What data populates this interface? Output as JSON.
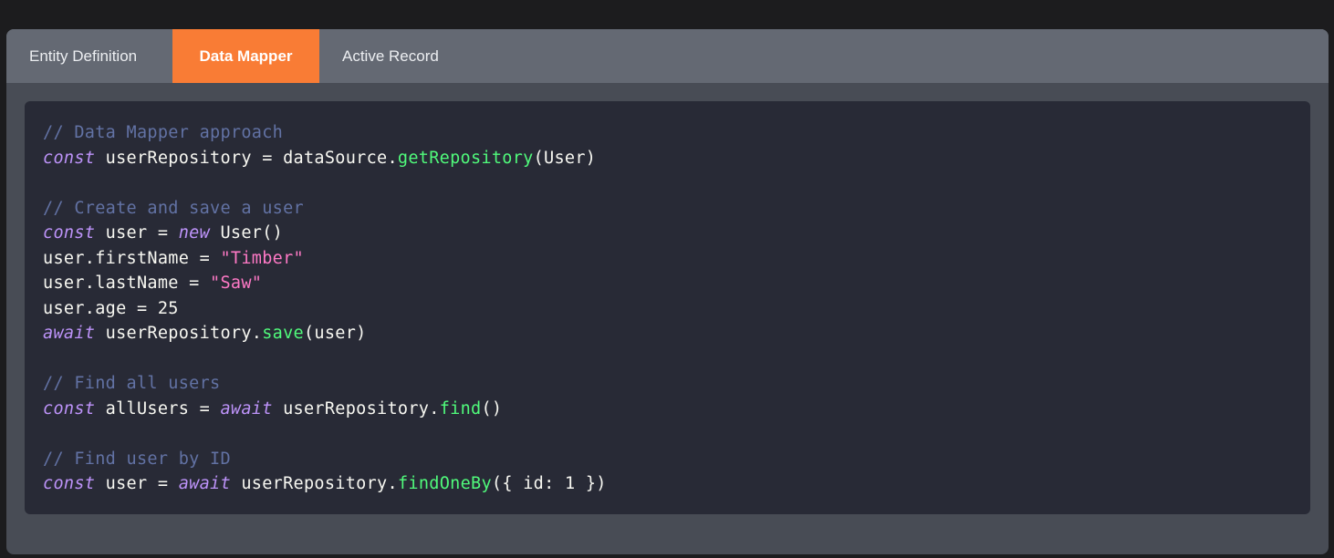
{
  "colors": {
    "active_tab": "#f97c35",
    "panel_bg": "#484c55",
    "tab_bar_bg": "#646973",
    "code_bg": "#282a36",
    "comment": "#6272a4",
    "keyword": "#bd93f9",
    "function": "#50fa7b",
    "string": "#ff79c6",
    "text": "#f8f8f2"
  },
  "tabs": [
    {
      "label": "Entity Definition",
      "active": false
    },
    {
      "label": "Data Mapper",
      "active": true
    },
    {
      "label": "Active Record",
      "active": false
    }
  ],
  "code": {
    "lines": [
      [
        {
          "t": "// Data Mapper approach",
          "k": "cm"
        }
      ],
      [
        {
          "t": "const",
          "k": "kw"
        },
        {
          "t": " userRepository = dataSource.",
          "k": "tx"
        },
        {
          "t": "getRepository",
          "k": "fn"
        },
        {
          "t": "(User)",
          "k": "tx"
        }
      ],
      [],
      [
        {
          "t": "// Create and save a user",
          "k": "cm"
        }
      ],
      [
        {
          "t": "const",
          "k": "kw"
        },
        {
          "t": " user = ",
          "k": "tx"
        },
        {
          "t": "new",
          "k": "kw"
        },
        {
          "t": " User()",
          "k": "tx"
        }
      ],
      [
        {
          "t": "user.firstName = ",
          "k": "tx"
        },
        {
          "t": "\"Timber\"",
          "k": "str"
        }
      ],
      [
        {
          "t": "user.lastName = ",
          "k": "tx"
        },
        {
          "t": "\"Saw\"",
          "k": "str"
        }
      ],
      [
        {
          "t": "user.age = 25",
          "k": "tx"
        }
      ],
      [
        {
          "t": "await",
          "k": "kw"
        },
        {
          "t": " userRepository.",
          "k": "tx"
        },
        {
          "t": "save",
          "k": "fn"
        },
        {
          "t": "(user)",
          "k": "tx"
        }
      ],
      [],
      [
        {
          "t": "// Find all users",
          "k": "cm"
        }
      ],
      [
        {
          "t": "const",
          "k": "kw"
        },
        {
          "t": " allUsers = ",
          "k": "tx"
        },
        {
          "t": "await",
          "k": "kw"
        },
        {
          "t": " userRepository.",
          "k": "tx"
        },
        {
          "t": "find",
          "k": "fn"
        },
        {
          "t": "()",
          "k": "tx"
        }
      ],
      [],
      [
        {
          "t": "// Find user by ID",
          "k": "cm"
        }
      ],
      [
        {
          "t": "const",
          "k": "kw"
        },
        {
          "t": " user = ",
          "k": "tx"
        },
        {
          "t": "await",
          "k": "kw"
        },
        {
          "t": " userRepository.",
          "k": "tx"
        },
        {
          "t": "findOneBy",
          "k": "fn"
        },
        {
          "t": "({ id: 1 })",
          "k": "tx"
        }
      ]
    ]
  }
}
